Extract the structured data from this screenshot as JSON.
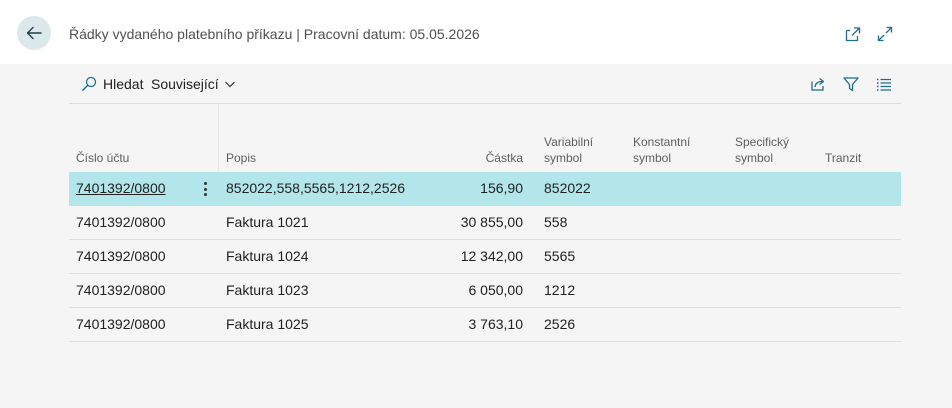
{
  "header": {
    "title": "Řádky vydaného platebního příkazu | Pracovní datum: 05.05.2026",
    "icons": [
      "back-arrow-icon",
      "open-in-new-window-icon",
      "expand-icon"
    ]
  },
  "actionbar": {
    "search_label": "Hledat",
    "related_label": "Související",
    "icons": [
      "search-icon",
      "chevron-down-icon",
      "share-icon",
      "filter-icon",
      "list-view-icon"
    ]
  },
  "table": {
    "columns": {
      "account": "Číslo účtu",
      "description": "Popis",
      "amount": "Částka",
      "variable_1": "Variabilní",
      "variable_2": "symbol",
      "constant_1": "Konstantní",
      "constant_2": "symbol",
      "specific_1": "Specifický",
      "specific_2": "symbol",
      "transit": "Tranzit"
    },
    "rows": [
      {
        "account": "7401392/0800",
        "description": "852022,558,5565,1212,2526",
        "amount": "156,90",
        "variable": "852022"
      },
      {
        "account": "7401392/0800",
        "description": "Faktura 1021",
        "amount": "30 855,00",
        "variable": "558"
      },
      {
        "account": "7401392/0800",
        "description": "Faktura 1024",
        "amount": "12 342,00",
        "variable": "5565"
      },
      {
        "account": "7401392/0800",
        "description": "Faktura 1023",
        "amount": "6 050,00",
        "variable": "1212"
      },
      {
        "account": "7401392/0800",
        "description": "Faktura 1025",
        "amount": "3 763,10",
        "variable": "2526"
      }
    ]
  },
  "colors": {
    "selected_row": "#b3e6ea",
    "back_button_bg": "#dde8ec",
    "accent_icon": "#1f6d8c"
  }
}
